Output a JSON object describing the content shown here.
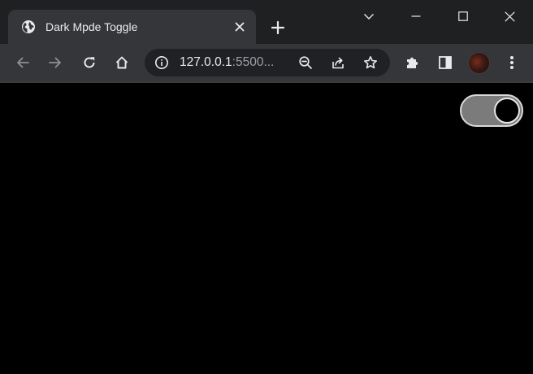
{
  "window": {
    "tab": {
      "title": "Dark Mpde Toggle",
      "favicon": "globe-icon"
    },
    "controls": [
      "chevron-down-icon",
      "minimize-icon",
      "maximize-icon",
      "close-icon"
    ]
  },
  "toolbar": {
    "url_host": "127.0.0.1",
    "url_rest": ":5500...",
    "buttons": [
      "back-icon",
      "forward-icon",
      "reload-icon",
      "home-icon",
      "zoom-out-icon",
      "share-icon",
      "star-icon",
      "extensions-icon",
      "side-panel-icon",
      "menu-icon"
    ]
  },
  "page": {
    "toggle": {
      "label": "dark-mode-toggle",
      "state": "on"
    }
  },
  "colors": {
    "tab_strip": "#1f2022",
    "toolbar": "#35363a",
    "omnibox": "#202124",
    "page_background": "#000000",
    "toggle_track": "#7b7b7b",
    "toggle_knob": "#000000"
  }
}
